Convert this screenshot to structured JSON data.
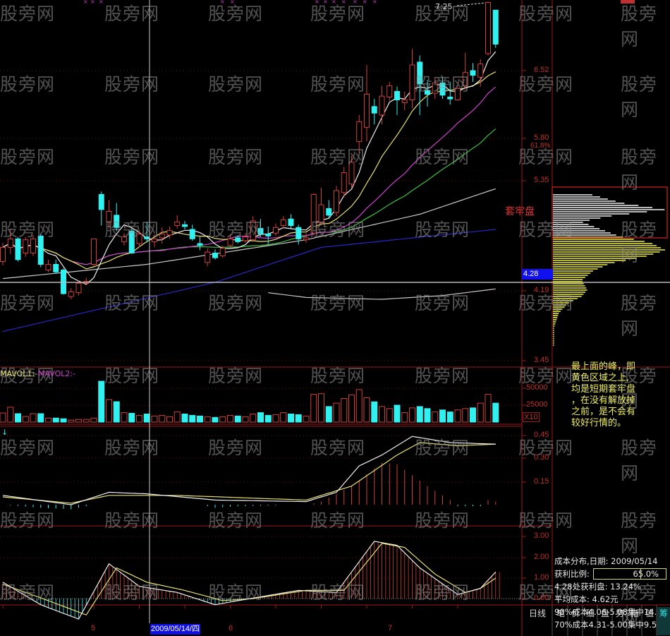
{
  "colors": {
    "up": "#d0403a",
    "down": "#30f0f0",
    "ma5": "#f0f0f0",
    "ma10": "#e8e070",
    "ma20": "#d040d0",
    "ma30": "#40c040",
    "ma60": "#c8c8c8",
    "ma120": "#2828c8",
    "grid": "#a01818"
  },
  "watermark": "股旁网",
  "price_axis": {
    "labels": [
      "6.52",
      "5.80",
      "61.8%",
      "5.35",
      "4.19",
      "3.45"
    ],
    "crosshair_price": "4.28",
    "high_label": "7.25"
  },
  "volume_axis": {
    "labels": [
      "50000",
      "25000"
    ],
    "multiplier": "X10",
    "legend1": "MAVOL1:-",
    "legend2": "MAVOL2:-"
  },
  "macd_axis": {
    "labels": [
      "0.45",
      "0.30",
      "0.15"
    ]
  },
  "osc_axis": {
    "labels": [
      "3.00",
      "2.00",
      "1.00",
      "0.00"
    ]
  },
  "x_axis": {
    "labels": [
      "5",
      "6",
      "7"
    ],
    "crosshair_date": "2009/05/14/四"
  },
  "trapped_label": "套牢盘",
  "note_lines": [
    "最上面的峰，即",
    "黄色区域之上,",
    "均是短期套牢盘",
    "，在没有解放掉",
    "之前，是不会有",
    "较好行情的。"
  ],
  "info": {
    "title": "成本分布,日期: 2009/05/14",
    "profit_label": "获利比例:",
    "profit_value": "65.0%",
    "profit_fraction": 0.65,
    "line3": "4.28处获利盘: 13.24%",
    "line4": "平均成本: 4.62元",
    "line5": "90%成本4.06-5.08集中14.0%",
    "line6": "70%成本4.31-5.00集中9.5%"
  },
  "tabs": [
    "日线",
    "笔",
    "价",
    "细",
    "盘",
    "势",
    "指",
    "值",
    "筹"
  ],
  "chart_data": {
    "type": "candlestick",
    "ohlc": [
      [
        4.5,
        4.7,
        4.46,
        4.65
      ],
      [
        4.65,
        4.84,
        4.58,
        4.74
      ],
      [
        4.74,
        4.76,
        4.5,
        4.52
      ],
      [
        4.59,
        4.76,
        4.55,
        4.73
      ],
      [
        4.59,
        4.78,
        4.56,
        4.74
      ],
      [
        4.77,
        4.79,
        4.44,
        4.47
      ],
      [
        4.41,
        4.52,
        4.39,
        4.47
      ],
      [
        4.47,
        4.52,
        4.37,
        4.39
      ],
      [
        4.41,
        4.43,
        4.15,
        4.16
      ],
      [
        4.13,
        4.22,
        4.1,
        4.18
      ],
      [
        4.17,
        4.3,
        4.14,
        4.27
      ],
      [
        4.27,
        4.33,
        4.25,
        4.29
      ],
      [
        4.47,
        4.74,
        4.45,
        4.74
      ],
      [
        5.21,
        5.24,
        4.88,
        5.05
      ],
      [
        4.92,
        5.15,
        4.85,
        5.03
      ],
      [
        4.99,
        5.12,
        4.82,
        4.86
      ],
      [
        4.71,
        4.8,
        4.67,
        4.76
      ],
      [
        4.82,
        4.84,
        4.58,
        4.59
      ],
      [
        4.69,
        4.83,
        4.65,
        4.79
      ],
      [
        4.76,
        4.92,
        4.7,
        4.74
      ],
      [
        4.71,
        4.79,
        4.65,
        4.74
      ],
      [
        4.75,
        4.86,
        4.69,
        4.79
      ],
      [
        4.78,
        4.87,
        4.74,
        4.83
      ],
      [
        4.88,
        4.99,
        4.85,
        4.92
      ],
      [
        4.89,
        4.93,
        4.84,
        4.87
      ],
      [
        4.84,
        4.89,
        4.72,
        4.74
      ],
      [
        4.69,
        4.76,
        4.62,
        4.67
      ],
      [
        4.49,
        4.64,
        4.45,
        4.6
      ],
      [
        4.59,
        4.63,
        4.52,
        4.54
      ],
      [
        4.56,
        4.67,
        4.54,
        4.64
      ],
      [
        4.67,
        4.79,
        4.65,
        4.74
      ],
      [
        4.75,
        4.78,
        4.69,
        4.71
      ],
      [
        4.72,
        4.8,
        4.7,
        4.76
      ],
      [
        4.73,
        4.98,
        4.71,
        4.93
      ],
      [
        4.85,
        4.95,
        4.76,
        4.79
      ],
      [
        4.79,
        4.87,
        4.68,
        4.77
      ],
      [
        4.8,
        4.9,
        4.77,
        4.86
      ],
      [
        4.88,
        4.98,
        4.85,
        4.94
      ],
      [
        4.95,
        5.0,
        4.85,
        4.88
      ],
      [
        4.86,
        4.89,
        4.68,
        4.74
      ],
      [
        4.73,
        4.8,
        4.7,
        4.75
      ],
      [
        4.8,
        5.22,
        4.78,
        5.21
      ],
      [
        4.91,
        5.28,
        4.88,
        5.1
      ],
      [
        5.06,
        5.15,
        4.96,
        4.99
      ],
      [
        5.02,
        5.3,
        4.98,
        5.25
      ],
      [
        5.23,
        5.5,
        5.18,
        5.44
      ],
      [
        5.32,
        5.62,
        5.28,
        5.55
      ],
      [
        5.77,
        6.05,
        5.65,
        5.98
      ],
      [
        5.92,
        6.58,
        5.77,
        6.27
      ],
      [
        6.14,
        6.22,
        5.95,
        6.07
      ],
      [
        6.05,
        6.36,
        5.95,
        6.25
      ],
      [
        6.24,
        6.4,
        6.2,
        6.36
      ],
      [
        6.3,
        6.35,
        6.05,
        6.21
      ],
      [
        6.18,
        6.3,
        6.1,
        6.21
      ],
      [
        6.21,
        6.75,
        6.12,
        6.58
      ],
      [
        6.61,
        6.68,
        6.05,
        6.38
      ],
      [
        6.31,
        6.42,
        6.14,
        6.27
      ],
      [
        6.28,
        6.45,
        6.22,
        6.39
      ],
      [
        6.39,
        6.45,
        6.22,
        6.26
      ],
      [
        6.24,
        6.4,
        6.16,
        6.22
      ],
      [
        6.21,
        6.35,
        6.2,
        6.33
      ],
      [
        6.36,
        6.71,
        6.32,
        6.5
      ],
      [
        6.52,
        6.6,
        6.4,
        6.47
      ],
      [
        6.45,
        6.64,
        6.35,
        6.59
      ],
      [
        6.7,
        7.25,
        6.68,
        7.24
      ],
      [
        7.16,
        7.16,
        6.76,
        6.8
      ]
    ],
    "volume": [
      13500,
      22000,
      12500,
      8300,
      12500,
      12500,
      6000,
      6000,
      5000,
      3000,
      4000,
      4000,
      6000,
      60400,
      33300,
      30200,
      14000,
      13000,
      10000,
      12000,
      9000,
      10000,
      8000,
      15000,
      12000,
      10000,
      9000,
      8000,
      7000,
      8000,
      10000,
      9000,
      8000,
      12000,
      14000,
      10000,
      11000,
      14000,
      12000,
      11000,
      9000,
      41000,
      42000,
      23000,
      28000,
      35000,
      40000,
      48000,
      36000,
      30000,
      23000,
      20000,
      25000,
      14000,
      21000,
      23000,
      20000,
      15000,
      18000,
      15000,
      18000,
      20000,
      21000,
      28000,
      41000,
      28000
    ],
    "ma60_keypoints": [
      [
        0,
        4.32
      ],
      [
        19,
        4.47
      ],
      [
        40,
        4.73
      ],
      [
        55,
        5.0
      ],
      [
        65,
        5.27
      ]
    ],
    "ma120_keypoints": [
      [
        0,
        3.76
      ],
      [
        28,
        4.28
      ],
      [
        42,
        4.65
      ],
      [
        65,
        4.84
      ]
    ],
    "cost_line_keypoints": [
      [
        35,
        4.17
      ],
      [
        40,
        4.12
      ],
      [
        50,
        4.1
      ],
      [
        58,
        4.14
      ],
      [
        65,
        4.21
      ]
    ],
    "chip_profile": [
      [
        5.3,
        0.05
      ],
      [
        5.22,
        0.3
      ],
      [
        5.12,
        0.6
      ],
      [
        5.05,
        0.98
      ],
      [
        4.98,
        0.5
      ],
      [
        4.92,
        0.25
      ],
      [
        4.85,
        0.4
      ],
      [
        4.78,
        0.55
      ],
      [
        4.76,
        0.6
      ],
      [
        4.7,
        0.85
      ],
      [
        4.62,
        0.98
      ],
      [
        4.55,
        0.8
      ],
      [
        4.48,
        0.5
      ],
      [
        4.4,
        0.35
      ],
      [
        4.3,
        0.25
      ],
      [
        4.2,
        0.3
      ],
      [
        4.13,
        0.25
      ],
      [
        4.05,
        0.12
      ],
      [
        3.95,
        0.05
      ],
      [
        3.8,
        0.01
      ]
    ],
    "chip_split_price": 4.77,
    "macd_dif": [
      [
        0,
        0.06
      ],
      [
        9,
        0.0
      ],
      [
        14,
        0.08
      ],
      [
        19,
        0.07
      ],
      [
        28,
        0.03
      ],
      [
        40,
        0.02
      ],
      [
        44,
        0.08
      ],
      [
        47,
        0.25
      ],
      [
        50,
        0.32
      ],
      [
        54,
        0.44
      ],
      [
        59,
        0.4
      ],
      [
        65,
        0.39
      ]
    ],
    "macd_dea": [
      [
        0,
        0.05
      ],
      [
        9,
        0.01
      ],
      [
        14,
        0.06
      ],
      [
        23,
        0.06
      ],
      [
        40,
        0.03
      ],
      [
        46,
        0.12
      ],
      [
        52,
        0.32
      ],
      [
        55,
        0.4
      ],
      [
        60,
        0.38
      ],
      [
        65,
        0.39
      ]
    ],
    "macd_hist": [
      [
        0,
        0.0
      ],
      [
        5,
        -0.02
      ],
      [
        9,
        -0.03
      ],
      [
        12,
        0.0
      ],
      [
        26,
        0.0
      ],
      [
        28,
        -0.02
      ],
      [
        31,
        -0.01
      ],
      [
        40,
        0.0
      ],
      [
        42,
        0.02
      ],
      [
        46,
        0.12
      ],
      [
        50,
        0.27
      ],
      [
        52,
        0.26
      ],
      [
        56,
        0.12
      ],
      [
        59,
        0.03
      ],
      [
        60,
        -0.01
      ],
      [
        63,
        -0.01
      ],
      [
        64,
        0.03
      ],
      [
        65,
        0.02
      ]
    ],
    "osc_k": [
      [
        0,
        0.8
      ],
      [
        5,
        -0.3
      ],
      [
        10,
        -1.0
      ],
      [
        14,
        1.7
      ],
      [
        18,
        0.6
      ],
      [
        23,
        0.3
      ],
      [
        28,
        -0.3
      ],
      [
        31,
        -0.1
      ],
      [
        39,
        0.4
      ],
      [
        44,
        0.3
      ],
      [
        49,
        2.8
      ],
      [
        52,
        2.6
      ],
      [
        55,
        1.5
      ],
      [
        60,
        0.2
      ],
      [
        63,
        0.5
      ],
      [
        65,
        1.3
      ]
    ],
    "osc_d": [
      [
        0,
        0.7
      ],
      [
        6,
        -0.1
      ],
      [
        11,
        -0.8
      ],
      [
        15,
        1.5
      ],
      [
        19,
        0.8
      ],
      [
        24,
        0.4
      ],
      [
        29,
        -0.1
      ],
      [
        33,
        0.0
      ],
      [
        40,
        0.4
      ],
      [
        45,
        0.4
      ],
      [
        50,
        2.7
      ],
      [
        53,
        2.5
      ],
      [
        57,
        1.2
      ],
      [
        61,
        0.3
      ],
      [
        63,
        0.5
      ],
      [
        65,
        1.0
      ]
    ]
  }
}
